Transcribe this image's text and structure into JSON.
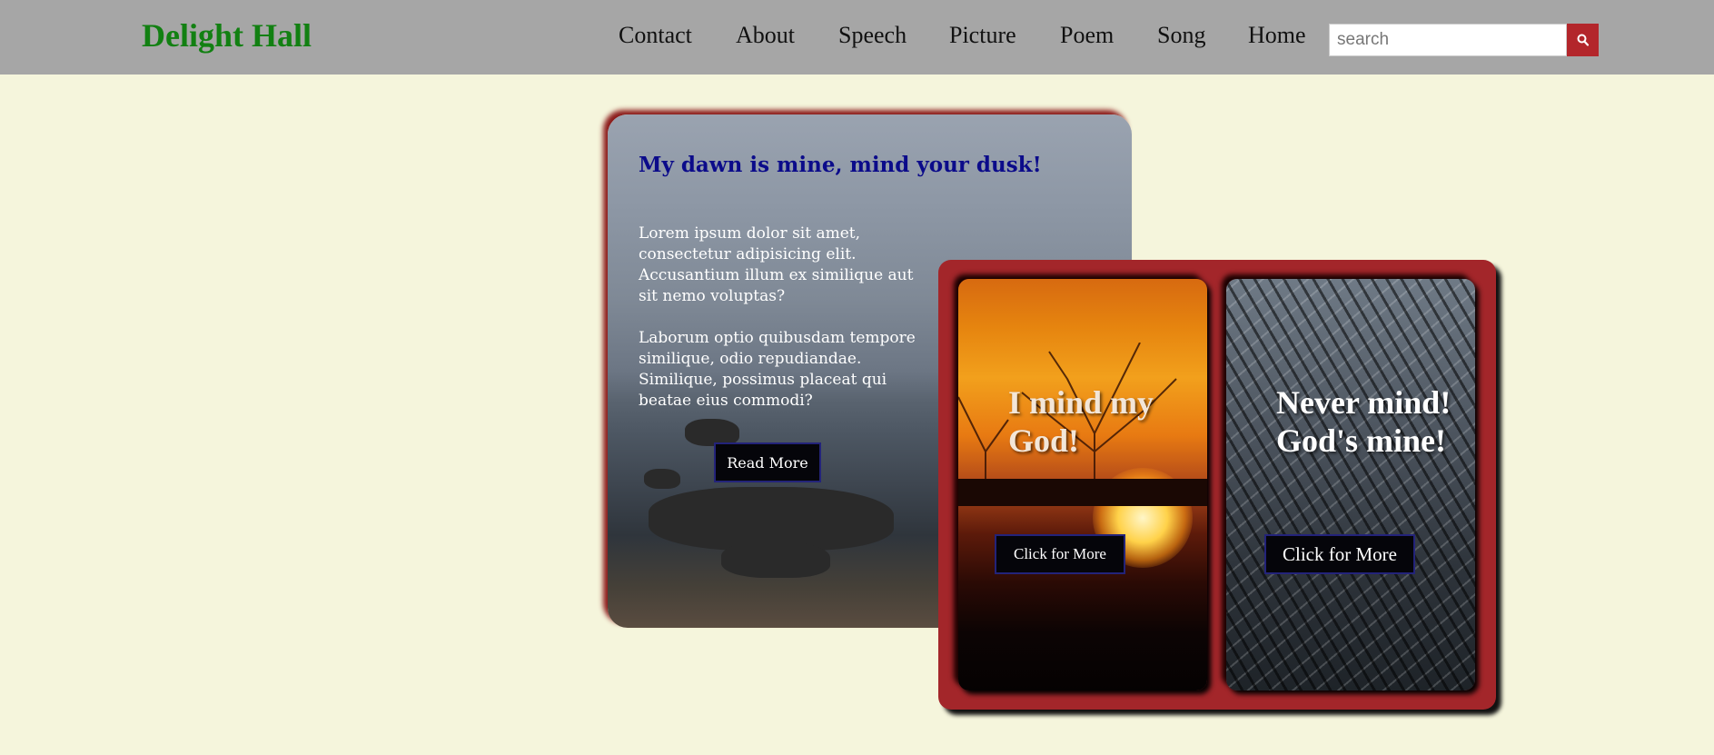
{
  "header": {
    "brand": "Delight Hall",
    "nav": [
      "Contact",
      "About",
      "Speech",
      "Picture",
      "Poem",
      "Song",
      "Home"
    ],
    "search_placeholder": "search",
    "search_icon": "search-icon"
  },
  "main_card": {
    "title": "My dawn is mine, mind your dusk!",
    "paragraphs": [
      "Lorem ipsum dolor sit amet, consectetur adipisicing elit. Accusantium illum ex similique aut sit nemo voluptas?",
      "Laborum optio quibusdam tempore similique, odio repudiandae. Similique, possimus placeat qui beatae eius commodi?"
    ],
    "button": "Read More"
  },
  "cards": [
    {
      "title": "I mind my God!",
      "button": "Click for More"
    },
    {
      "title": "Never mind! God's mine!",
      "button": "Click for More"
    }
  ],
  "colors": {
    "background": "#f5f5dc",
    "header": "#a6a6a6",
    "brand": "#128012",
    "accent_red": "#a3262a",
    "title_blue": "#0b0b8a"
  }
}
